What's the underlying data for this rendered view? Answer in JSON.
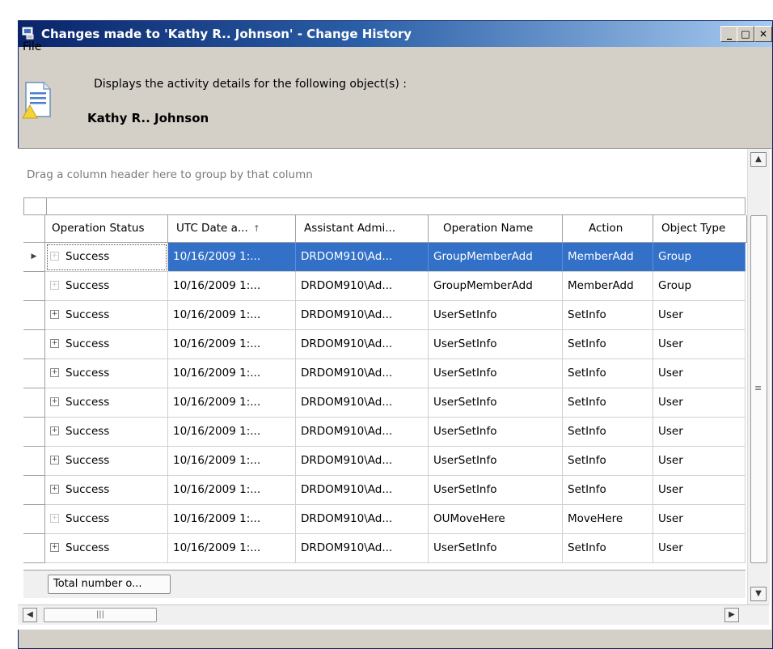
{
  "window": {
    "title": "Changes made to 'Kathy R.. Johnson' - Change History",
    "minimize": "_",
    "maximize": "□",
    "close": "✕"
  },
  "menu": {
    "file": "File"
  },
  "header": {
    "description": "Displays the activity details for the following object(s) :",
    "object_name": "Kathy R.. Johnson"
  },
  "grid": {
    "group_by_hint": "Drag a column header here to group by that column",
    "columns": [
      "Operation Status",
      "UTC Date a...",
      "Assistant Admi...",
      "Operation Name",
      "Action",
      "Object Type"
    ],
    "sort_indicator": "↑",
    "rows": [
      {
        "status": "Success",
        "date": "10/16/2009 1:...",
        "admin": "DRDOM910\\Ad...",
        "operation": "GroupMemberAdd",
        "action": "MemberAdd",
        "type": "Group"
      },
      {
        "status": "Success",
        "date": "10/16/2009 1:...",
        "admin": "DRDOM910\\Ad...",
        "operation": "GroupMemberAdd",
        "action": "MemberAdd",
        "type": "Group"
      },
      {
        "status": "Success",
        "date": "10/16/2009 1:...",
        "admin": "DRDOM910\\Ad...",
        "operation": "UserSetInfo",
        "action": "SetInfo",
        "type": "User"
      },
      {
        "status": "Success",
        "date": "10/16/2009 1:...",
        "admin": "DRDOM910\\Ad...",
        "operation": "UserSetInfo",
        "action": "SetInfo",
        "type": "User"
      },
      {
        "status": "Success",
        "date": "10/16/2009 1:...",
        "admin": "DRDOM910\\Ad...",
        "operation": "UserSetInfo",
        "action": "SetInfo",
        "type": "User"
      },
      {
        "status": "Success",
        "date": "10/16/2009 1:...",
        "admin": "DRDOM910\\Ad...",
        "operation": "UserSetInfo",
        "action": "SetInfo",
        "type": "User"
      },
      {
        "status": "Success",
        "date": "10/16/2009 1:...",
        "admin": "DRDOM910\\Ad...",
        "operation": "UserSetInfo",
        "action": "SetInfo",
        "type": "User"
      },
      {
        "status": "Success",
        "date": "10/16/2009 1:...",
        "admin": "DRDOM910\\Ad...",
        "operation": "UserSetInfo",
        "action": "SetInfo",
        "type": "User"
      },
      {
        "status": "Success",
        "date": "10/16/2009 1:...",
        "admin": "DRDOM910\\Ad...",
        "operation": "UserSetInfo",
        "action": "SetInfo",
        "type": "User"
      },
      {
        "status": "Success",
        "date": "10/16/2009 1:...",
        "admin": "DRDOM910\\Ad...",
        "operation": "OUMoveHere",
        "action": "MoveHere",
        "type": "User"
      },
      {
        "status": "Success",
        "date": "10/16/2009 1:...",
        "admin": "DRDOM910\\Ad...",
        "operation": "UserSetInfo",
        "action": "SetInfo",
        "type": "User"
      }
    ],
    "total_label": "Total number o..."
  },
  "colors": {
    "title_start": "#0a246a",
    "title_end": "#a6caf0",
    "selection": "#3370c8",
    "window_bg": "#d4d0c8"
  }
}
